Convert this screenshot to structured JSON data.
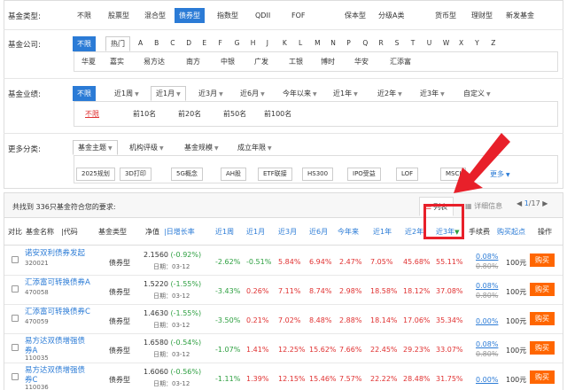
{
  "filters": {
    "fund_type": {
      "label": "基金类型:",
      "options": [
        "不限",
        "股票型",
        "混合型",
        "债券型",
        "指数型",
        "QDII",
        "FOF",
        "保本型",
        "分级A类",
        "货币型",
        "理财型",
        "新发基金"
      ],
      "active": "债券型"
    },
    "company": {
      "label": "基金公司:",
      "unlimited": "不限",
      "hot": "热门",
      "letters": [
        "A",
        "B",
        "C",
        "D",
        "E",
        "F",
        "G",
        "H",
        "J",
        "K",
        "L",
        "M",
        "N",
        "P",
        "Q",
        "R",
        "S",
        "T",
        "U",
        "W",
        "X",
        "Y",
        "Z"
      ],
      "names": [
        "华夏",
        "嘉实",
        "易方达",
        "南方",
        "中银",
        "广发",
        "工银",
        "博时",
        "华安",
        "汇添富"
      ]
    },
    "performance": {
      "label": "基金业绩:",
      "unlimited": "不限",
      "periods": [
        "近1周",
        "近1月",
        "近3月",
        "近6月",
        "今年以来",
        "近1年",
        "近2年",
        "近3年",
        "自定义"
      ],
      "ranks": [
        "不限",
        "前10名",
        "前20名",
        "前50名",
        "前100名"
      ]
    },
    "more": {
      "label": "更多分类:",
      "tabs": [
        "基金主题",
        "机构评级",
        "基金规模",
        "成立年限"
      ],
      "tags": [
        "2025规划",
        "3D打印",
        "5G概念",
        "AH股",
        "ETF联接",
        "HS300",
        "IPO受益",
        "LOF",
        "MSCI"
      ],
      "more_label": "更多"
    }
  },
  "results": {
    "summary_prefix": "共找到",
    "summary_count": "336",
    "summary_suffix": "只基金符合您的要求:",
    "view_list": "列表",
    "view_detail": "详细信息",
    "page_current": "1",
    "page_total": "/17"
  },
  "table": {
    "headers": {
      "compare": "对比",
      "name": "基金名称",
      "code": "代码",
      "type": "基金类型",
      "nav": "净值",
      "daily": "日增长率",
      "w1": "近1周",
      "m1": "近1月",
      "m3": "近3月",
      "m6": "近6月",
      "ytd": "今年来",
      "y1": "近1年",
      "y2": "近2年",
      "y3": "近3年",
      "fee": "手续费",
      "min": "购买起点",
      "op": "操作"
    },
    "rows": [
      {
        "name": "诺安双利债券发起",
        "name2": "",
        "code": "320021",
        "type": "债券型",
        "nav": "2.1560",
        "chg": "(-0.92%)",
        "date": "日期：03-12",
        "w1": "-2.62%",
        "m1": "-0.51%",
        "m3": "5.84%",
        "m6": "6.94%",
        "ytd": "2.47%",
        "y1": "7.05%",
        "y2": "45.68%",
        "y3": "55.11%",
        "fee": "0.08%",
        "fee_old": "0.80%",
        "min": "100元",
        "buy": "购买"
      },
      {
        "name": "汇添富可转换债券A",
        "name2": "",
        "code": "470058",
        "type": "债券型",
        "nav": "1.5220",
        "chg": "(-1.55%)",
        "date": "日期：03-12",
        "w1": "-3.43%",
        "m1": "0.26%",
        "m3": "7.11%",
        "m6": "8.74%",
        "ytd": "2.98%",
        "y1": "18.58%",
        "y2": "18.12%",
        "y3": "37.08%",
        "fee": "0.08%",
        "fee_old": "0.80%",
        "min": "100元",
        "buy": "购买"
      },
      {
        "name": "汇添富可转换债券C",
        "name2": "",
        "code": "470059",
        "type": "债券型",
        "nav": "1.4630",
        "chg": "(-1.55%)",
        "date": "日期：03-12",
        "w1": "-3.50%",
        "m1": "0.21%",
        "m3": "7.02%",
        "m6": "8.48%",
        "ytd": "2.88%",
        "y1": "18.14%",
        "y2": "17.06%",
        "y3": "35.34%",
        "fee": "0.00%",
        "fee_old": "",
        "min": "100元",
        "buy": "购买"
      },
      {
        "name": "易方达双债增强债",
        "name2": "券A",
        "code": "110035",
        "type": "债券型",
        "nav": "1.6580",
        "chg": "(-0.54%)",
        "date": "日期：03-12",
        "w1": "-1.07%",
        "m1": "1.41%",
        "m3": "12.25%",
        "m6": "15.62%",
        "ytd": "7.66%",
        "y1": "22.45%",
        "y2": "29.23%",
        "y3": "33.07%",
        "fee": "0.08%",
        "fee_old": "0.80%",
        "min": "100元",
        "buy": "购买"
      },
      {
        "name": "易方达双债增强债",
        "name2": "券C",
        "code": "110036",
        "type": "债券型",
        "nav": "1.6060",
        "chg": "(-0.56%)",
        "date": "日期：03-12",
        "w1": "-1.11%",
        "m1": "1.39%",
        "m3": "12.15%",
        "m6": "15.46%",
        "ytd": "7.57%",
        "y1": "22.22%",
        "y2": "28.48%",
        "y3": "31.75%",
        "fee": "0.00%",
        "fee_old": "",
        "min": "100元",
        "buy": "购买"
      }
    ]
  },
  "colors": {
    "accent": "#2b7bd6",
    "positive": "#e03131",
    "negative": "#2d9f40",
    "buy": "#ff6600",
    "highlight": "#e8202a"
  }
}
